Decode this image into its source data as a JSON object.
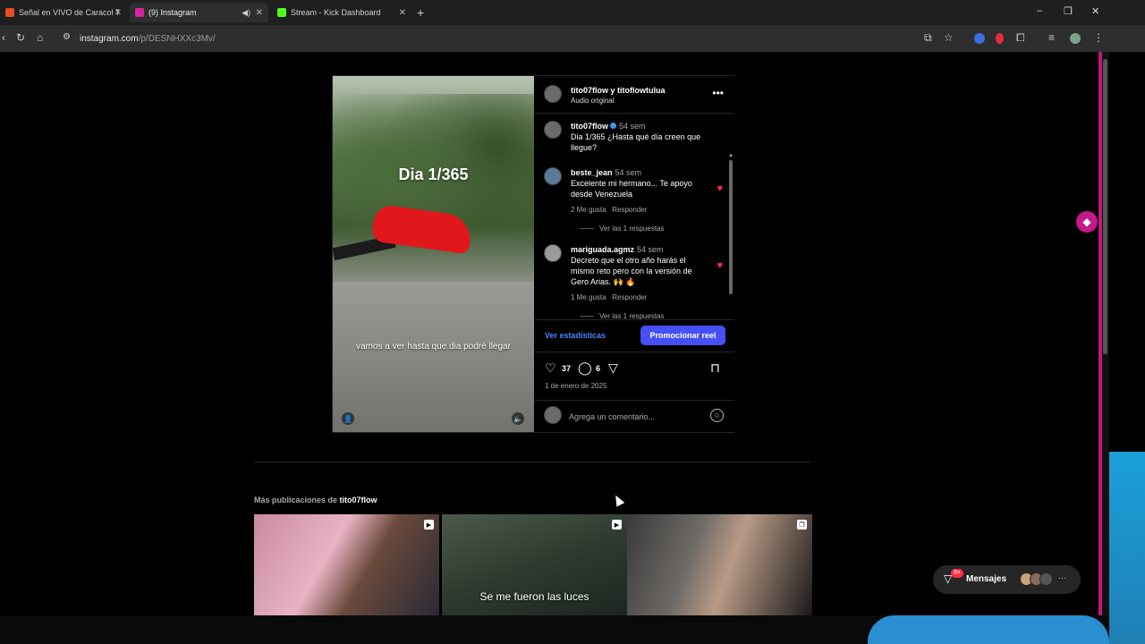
{
  "browser": {
    "tabs": [
      {
        "title": "Señal en VIVO de Caracol Telev",
        "favicon_color": "#e34c26"
      },
      {
        "title": "(9) Instagram",
        "favicon_color": "#d6249f"
      },
      {
        "title": "Stream - Kick Dashboard",
        "favicon_color": "#53fc18"
      }
    ],
    "close_glyph": "✕",
    "new_tab_glyph": "+",
    "window_controls": {
      "minimize": "–",
      "restore": "❐",
      "close": "✕"
    },
    "url_host": "instagram.com",
    "url_path": "/p/DESNHXXc3Mv/"
  },
  "post": {
    "users": "tito07flow y titoflowtulua",
    "audio": "Audio original",
    "more_glyph": "•••",
    "video": {
      "title": "Dia 1/365",
      "caption": "vamos a ver hasta que dia podré llegar"
    },
    "comments": [
      {
        "user": "tito07flow",
        "time": "54 sem",
        "text": "Dia 1/365 ¿Hasta qué día creen que llegue?"
      },
      {
        "user": "beste_jean",
        "time": "54 sem",
        "text": "Excelente mi hermano... Te apoyo desde Venezuela",
        "likes": "2 Me gusta",
        "reply": "Responder",
        "replies": "Ver las 1 respuestas"
      },
      {
        "user": "mariguada.agmz",
        "time": "54 sem",
        "text": "Decreto que el otro año harás el mismo reto pero con la versión de Gero Arias. 🙌 🔥",
        "likes": "1 Me gusta",
        "reply": "Responder",
        "replies": "Ver las 1 respuestas"
      }
    ],
    "stats_link": "Ver estadísticas",
    "promote_button": "Promocionar reel",
    "likes": "37",
    "comments_count": "6",
    "date": "1 de enero de 2025",
    "comment_placeholder": "Agrega un comentario..."
  },
  "more_posts": {
    "prefix": "Más publicaciones de",
    "user": "tito07flow",
    "thumbs": [
      {
        "text": ""
      },
      {
        "text": "Se me fueron las luces"
      },
      {
        "text": ""
      }
    ]
  },
  "messages": {
    "label": "Mensajes",
    "badge": "9+"
  },
  "colors": {
    "accent": "#4650f5",
    "link": "#4a86ff",
    "heart": "#ff3040",
    "edge_pink": "#c0187f"
  }
}
